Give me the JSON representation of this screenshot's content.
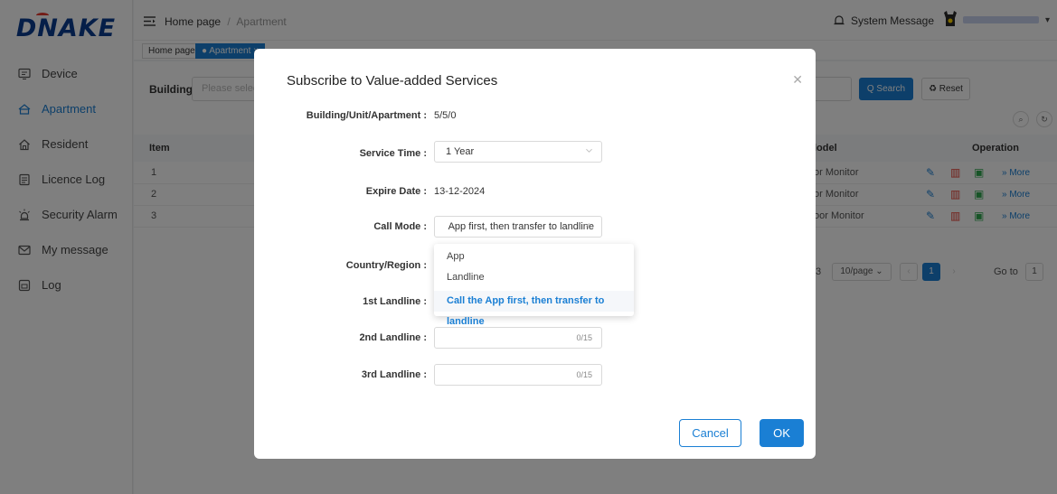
{
  "app": {
    "logo": "DNAKE"
  },
  "sidebar": {
    "items": [
      {
        "label": "Device",
        "icon": "device-icon"
      },
      {
        "label": "Apartment",
        "icon": "apartment-icon",
        "active": true
      },
      {
        "label": "Resident",
        "icon": "home-icon"
      },
      {
        "label": "Licence Log",
        "icon": "document-icon"
      },
      {
        "label": "Security Alarm",
        "icon": "alarm-light-icon"
      },
      {
        "label": "My message",
        "icon": "message-icon"
      },
      {
        "label": "Log",
        "icon": "log-icon"
      }
    ]
  },
  "header": {
    "breadcrumb": {
      "home": "Home page",
      "separator": "/",
      "current": "Apartment"
    },
    "system_message": "System Message"
  },
  "tabs": [
    {
      "label": "Home page"
    },
    {
      "label": "● Apartment ×",
      "active": true
    }
  ],
  "main": {
    "filter": {
      "building_label": "Building",
      "building_placeholder": "Please select"
    },
    "search_label": "Q Search",
    "reset_label": "♻ Reset",
    "table": {
      "headers": {
        "item": "Item",
        "model": "lodel",
        "operation": "Operation"
      },
      "rows": [
        {
          "item": "1",
          "model": "or Monitor",
          "more": "» More"
        },
        {
          "item": "2",
          "model": "or Monitor",
          "more": "» More"
        },
        {
          "item": "3",
          "model": "oor Monitor",
          "more": "» More"
        }
      ]
    },
    "pagination": {
      "total": "3",
      "page_size": "10/page",
      "current_page": "1",
      "goto_label": "Go to",
      "goto_value": "1"
    }
  },
  "modal": {
    "title": "Subscribe to Value-added Services",
    "fields": {
      "building_unit_label": "Building/Unit/Apartment :",
      "building_unit_value": "5/5/0",
      "service_time_label": "Service Time :",
      "service_time_value": "1 Year",
      "expire_label": "Expire Date :",
      "expire_value": "13-12-2024",
      "call_mode_label": "Call Mode :",
      "call_mode_value": "Call the App first, then transfer to landline",
      "country_label": "Country/Region :",
      "landline1_label": "1st Landline :",
      "landline2_label": "2nd Landline :",
      "landline2_count": "0/15",
      "landline3_label": "3rd Landline :",
      "landline3_count": "0/15"
    },
    "call_mode_options": [
      "App",
      "Landline",
      "Call the App first, then transfer to landline"
    ],
    "cancel_label": "Cancel",
    "ok_label": "OK"
  },
  "colors": {
    "primary": "#1a7fd4",
    "brand": "#0b3d91",
    "danger": "#e63b2e",
    "success": "#2fa84f"
  }
}
